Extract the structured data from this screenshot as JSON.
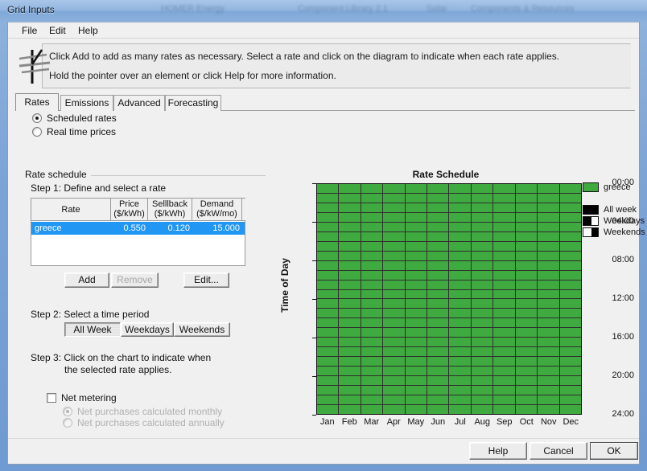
{
  "window": {
    "title": "Grid Inputs",
    "ghost_texts": [
      "HOMER Energy",
      "Component Library 2.1",
      "Solar",
      "Components & Resources"
    ]
  },
  "menu": [
    {
      "label": "File"
    },
    {
      "label": "Edit"
    },
    {
      "label": "Help"
    }
  ],
  "hint": {
    "line1": "Click Add to add as many rates as necessary.  Select a rate and click on the diagram to indicate when each rate applies.",
    "line2": "Hold the pointer over an element or click Help for more information.",
    "icon": "power-pole-icon"
  },
  "tabs": [
    {
      "label": "Rates",
      "active": true
    },
    {
      "label": "Emissions",
      "active": false
    },
    {
      "label": "Advanced",
      "active": false
    },
    {
      "label": "Forecasting",
      "active": false
    }
  ],
  "rate_mode": {
    "scheduled_label": "Scheduled rates",
    "realtime_label": "Real time prices",
    "selected": "scheduled"
  },
  "group": {
    "title": "Rate schedule",
    "step1_label": "Step 1:  Define and select a rate",
    "step2_label": "Step 2:  Select a time period",
    "step3_line1": "Step 3:  Click on the chart to indicate when",
    "step3_line2": "the selected rate applies."
  },
  "rate_table": {
    "columns": [
      {
        "name": "Rate",
        "unit": ""
      },
      {
        "name": "Price",
        "unit": "($/kWh)"
      },
      {
        "name": "Selllback",
        "unit": "($/kWh)"
      },
      {
        "name": "Demand",
        "unit": "($/kW/mo)"
      }
    ],
    "rows": [
      {
        "rate": "greece",
        "price": "0.550",
        "sellback": "0.120",
        "demand": "15.000",
        "selected": true
      }
    ]
  },
  "rate_buttons": {
    "add": "Add",
    "remove": "Remove",
    "edit": "Edit..."
  },
  "time_period": {
    "options": [
      "All Week",
      "Weekdays",
      "Weekends"
    ],
    "selected": "All Week"
  },
  "net_metering": {
    "label": "Net metering",
    "checked": false,
    "monthly_label": "Net purchases calculated monthly",
    "annually_label": "Net purchases calculated annually",
    "selected": "monthly",
    "enabled": false
  },
  "dialog_buttons": {
    "help": "Help",
    "cancel": "Cancel",
    "ok": "OK",
    "default": "OK"
  },
  "chart_data": {
    "type": "heatmap",
    "title": "Rate Schedule",
    "xlabel": "",
    "ylabel": "Time of Day",
    "categories": [
      "Jan",
      "Feb",
      "Mar",
      "Apr",
      "May",
      "Jun",
      "Jul",
      "Aug",
      "Sep",
      "Oct",
      "Nov",
      "Dec"
    ],
    "y_ticks": [
      "00:00",
      "04:00",
      "08:00",
      "12:00",
      "16:00",
      "20:00",
      "24:00"
    ],
    "y_tick_hours": [
      0,
      4,
      8,
      12,
      16,
      20,
      24
    ],
    "ylim": [
      0,
      24
    ],
    "rows": 24,
    "cols": 12,
    "grid": true,
    "fill_color": "#3faa3f",
    "grid_line_color": "#111111",
    "cells_note": "All 12 months x 24 hours assigned to rate 'greece'",
    "values": [
      [
        "greece",
        "greece",
        "greece",
        "greece",
        "greece",
        "greece",
        "greece",
        "greece",
        "greece",
        "greece",
        "greece",
        "greece"
      ],
      [
        "greece",
        "greece",
        "greece",
        "greece",
        "greece",
        "greece",
        "greece",
        "greece",
        "greece",
        "greece",
        "greece",
        "greece"
      ],
      [
        "greece",
        "greece",
        "greece",
        "greece",
        "greece",
        "greece",
        "greece",
        "greece",
        "greece",
        "greece",
        "greece",
        "greece"
      ],
      [
        "greece",
        "greece",
        "greece",
        "greece",
        "greece",
        "greece",
        "greece",
        "greece",
        "greece",
        "greece",
        "greece",
        "greece"
      ],
      [
        "greece",
        "greece",
        "greece",
        "greece",
        "greece",
        "greece",
        "greece",
        "greece",
        "greece",
        "greece",
        "greece",
        "greece"
      ],
      [
        "greece",
        "greece",
        "greece",
        "greece",
        "greece",
        "greece",
        "greece",
        "greece",
        "greece",
        "greece",
        "greece",
        "greece"
      ],
      [
        "greece",
        "greece",
        "greece",
        "greece",
        "greece",
        "greece",
        "greece",
        "greece",
        "greece",
        "greece",
        "greece",
        "greece"
      ],
      [
        "greece",
        "greece",
        "greece",
        "greece",
        "greece",
        "greece",
        "greece",
        "greece",
        "greece",
        "greece",
        "greece",
        "greece"
      ],
      [
        "greece",
        "greece",
        "greece",
        "greece",
        "greece",
        "greece",
        "greece",
        "greece",
        "greece",
        "greece",
        "greece",
        "greece"
      ],
      [
        "greece",
        "greece",
        "greece",
        "greece",
        "greece",
        "greece",
        "greece",
        "greece",
        "greece",
        "greece",
        "greece",
        "greece"
      ],
      [
        "greece",
        "greece",
        "greece",
        "greece",
        "greece",
        "greece",
        "greece",
        "greece",
        "greece",
        "greece",
        "greece",
        "greece"
      ],
      [
        "greece",
        "greece",
        "greece",
        "greece",
        "greece",
        "greece",
        "greece",
        "greece",
        "greece",
        "greece",
        "greece",
        "greece"
      ],
      [
        "greece",
        "greece",
        "greece",
        "greece",
        "greece",
        "greece",
        "greece",
        "greece",
        "greece",
        "greece",
        "greece",
        "greece"
      ],
      [
        "greece",
        "greece",
        "greece",
        "greece",
        "greece",
        "greece",
        "greece",
        "greece",
        "greece",
        "greece",
        "greece",
        "greece"
      ],
      [
        "greece",
        "greece",
        "greece",
        "greece",
        "greece",
        "greece",
        "greece",
        "greece",
        "greece",
        "greece",
        "greece",
        "greece"
      ],
      [
        "greece",
        "greece",
        "greece",
        "greece",
        "greece",
        "greece",
        "greece",
        "greece",
        "greece",
        "greece",
        "greece",
        "greece"
      ],
      [
        "greece",
        "greece",
        "greece",
        "greece",
        "greece",
        "greece",
        "greece",
        "greece",
        "greece",
        "greece",
        "greece",
        "greece"
      ],
      [
        "greece",
        "greece",
        "greece",
        "greece",
        "greece",
        "greece",
        "greece",
        "greece",
        "greece",
        "greece",
        "greece",
        "greece"
      ],
      [
        "greece",
        "greece",
        "greece",
        "greece",
        "greece",
        "greece",
        "greece",
        "greece",
        "greece",
        "greece",
        "greece",
        "greece"
      ],
      [
        "greece",
        "greece",
        "greece",
        "greece",
        "greece",
        "greece",
        "greece",
        "greece",
        "greece",
        "greece",
        "greece",
        "greece"
      ],
      [
        "greece",
        "greece",
        "greece",
        "greece",
        "greece",
        "greece",
        "greece",
        "greece",
        "greece",
        "greece",
        "greece",
        "greece"
      ],
      [
        "greece",
        "greece",
        "greece",
        "greece",
        "greece",
        "greece",
        "greece",
        "greece",
        "greece",
        "greece",
        "greece",
        "greece"
      ],
      [
        "greece",
        "greece",
        "greece",
        "greece",
        "greece",
        "greece",
        "greece",
        "greece",
        "greece",
        "greece",
        "greece",
        "greece"
      ],
      [
        "greece",
        "greece",
        "greece",
        "greece",
        "greece",
        "greece",
        "greece",
        "greece",
        "greece",
        "greece",
        "greece",
        "greece"
      ]
    ],
    "legend_position": "right",
    "legend": [
      {
        "label": "greece",
        "color": "#3faa3f",
        "style": "solid"
      },
      {
        "label": "All week",
        "color": "#000000",
        "style": "solid-black"
      },
      {
        "label": "Weekdays",
        "color": "#000000",
        "style": "left-black"
      },
      {
        "label": "Weekends",
        "color": "#000000",
        "style": "right-black"
      }
    ]
  }
}
